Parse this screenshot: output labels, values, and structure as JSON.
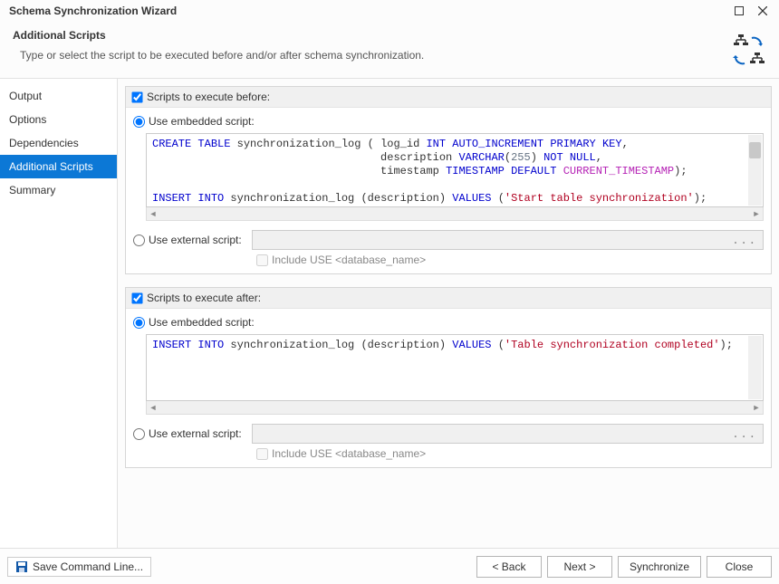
{
  "window": {
    "title": "Schema Synchronization Wizard",
    "subheading": "Additional Scripts",
    "description": "Type or select the script to be executed before and/or after schema synchronization."
  },
  "sidebar": {
    "items": [
      {
        "label": "Output"
      },
      {
        "label": "Options"
      },
      {
        "label": "Dependencies"
      },
      {
        "label": "Additional Scripts",
        "active": true
      },
      {
        "label": "Summary"
      }
    ]
  },
  "before": {
    "header": "Scripts to execute before:",
    "use_embedded": "Use embedded script:",
    "embedded_checked": true,
    "enabled": true,
    "use_external": "Use external script:",
    "external_placeholder": "...",
    "include_use": "Include USE <database_name>",
    "script": {
      "l1a": "CREATE",
      "l1b": " TABLE",
      "l1c": " synchronization_log ( log_id ",
      "l1d": "INT",
      "l1e": " AUTO_INCREMENT",
      "l1f": "PRIMARY",
      "l1g": "KEY",
      "l1h": ",",
      "l2a": "                                   description ",
      "l2b": "VARCHAR",
      "l2c": "(",
      "l2d": "255",
      "l2e": ") ",
      "l2f": "NOT",
      "l2g": "NULL",
      "l2h": ",",
      "l3a": "                                   timestamp ",
      "l3b": "TIMESTAMP",
      "l3c": "DEFAULT",
      "l3d": "CURRENT_TIMESTAMP",
      "l3e": ");",
      "l5a": "INSERT",
      "l5b": "INTO",
      "l5c": " synchronization_log (description) ",
      "l5d": "VALUES",
      "l5e": " (",
      "l5f": "'Start table synchronization'",
      "l5g": ");"
    }
  },
  "after": {
    "header": "Scripts to execute after:",
    "use_embedded": "Use embedded script:",
    "embedded_checked": true,
    "enabled": true,
    "use_external": "Use external script:",
    "external_placeholder": "...",
    "include_use": "Include USE <database_name>",
    "script": {
      "l1a": "INSERT",
      "l1b": "INTO",
      "l1c": " synchronization_log (description) ",
      "l1d": "VALUES",
      "l1e": " (",
      "l1f": "'Table synchronization completed'",
      "l1g": ");"
    }
  },
  "footer": {
    "save_cmd": "Save Command Line...",
    "back": "< Back",
    "next": "Next >",
    "synchronize": "Synchronize",
    "close": "Close"
  }
}
